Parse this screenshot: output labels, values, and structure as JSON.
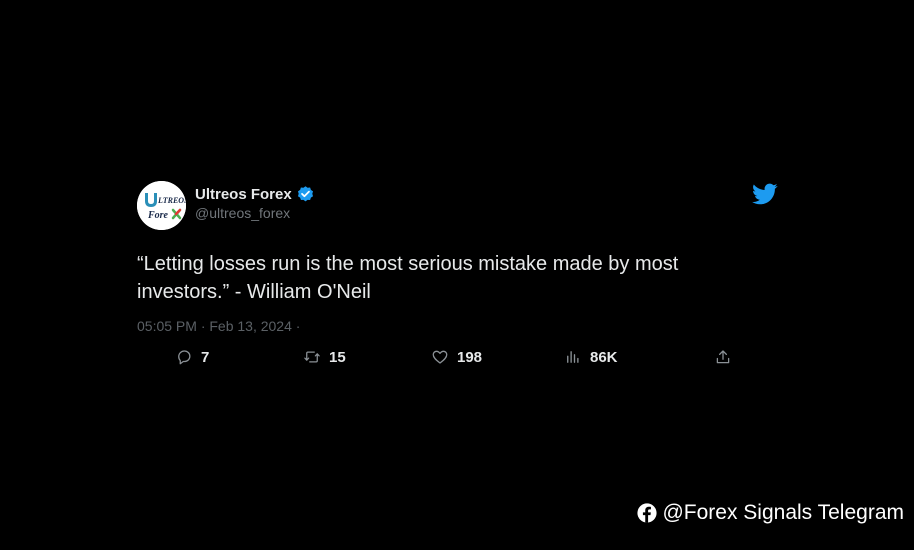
{
  "theme": {
    "background": "#000000",
    "text_primary": "#e7e9ea",
    "text_secondary": "#71767b",
    "twitter_blue": "#1d9bf0",
    "action_gray": "#8b9196"
  },
  "tweet": {
    "author": {
      "display_name": "Ultreos Forex",
      "handle": "@ultreos_forex",
      "verified": true,
      "avatar_logo": {
        "line1": "LTREOS",
        "line2": "Fore"
      }
    },
    "text": "“Letting losses run is the most serious mistake made by most\ninvestors.” - William O'Neil",
    "meta": "05:05 PM · Feb 13, 2024 ·",
    "icons": {
      "brand": "twitter-bird-icon",
      "verified": "verified-badge-icon"
    },
    "stats": {
      "replies": "7",
      "retweets": "15",
      "likes": "198",
      "views": "86K"
    }
  },
  "watermark": {
    "icon": "facebook-icon",
    "text": "@Forex Signals Telegram"
  }
}
